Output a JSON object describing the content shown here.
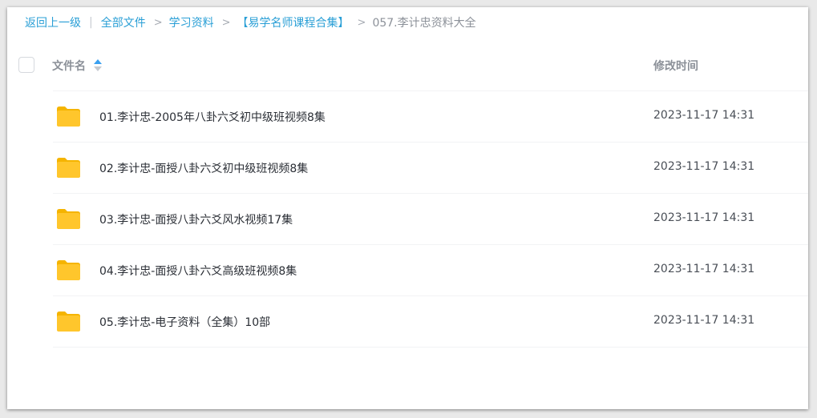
{
  "breadcrumb": {
    "back": "返回上一级",
    "items": [
      "全部文件",
      "学习资料",
      "【易学名师课程合集】"
    ],
    "current": "057.李计忠资料大全",
    "separator": ">",
    "divider": "|"
  },
  "table": {
    "headers": {
      "name": "文件名",
      "modified": "修改时间"
    },
    "sort": {
      "column": "name",
      "direction": "ascending"
    },
    "rows": [
      {
        "icon": "folder-icon",
        "name": "01.李计忠-2005年八卦六爻初中级班视频8集",
        "modified": "2023-11-17 14:31"
      },
      {
        "icon": "folder-icon",
        "name": "02.李计忠-面授八卦六爻初中级班视频8集",
        "modified": "2023-11-17 14:31"
      },
      {
        "icon": "folder-icon",
        "name": "03.李计忠-面授八卦六爻风水视频17集",
        "modified": "2023-11-17 14:31"
      },
      {
        "icon": "folder-icon",
        "name": "04.李计忠-面授八卦六爻高级班视频8集",
        "modified": "2023-11-17 14:31"
      },
      {
        "icon": "folder-icon",
        "name": "05.李计忠-电子资料（全集）10部",
        "modified": "2023-11-17 14:31"
      }
    ]
  },
  "colors": {
    "link": "#2a9fd6",
    "folder": "#ffc62c",
    "sort_active": "#3aa0f0"
  }
}
